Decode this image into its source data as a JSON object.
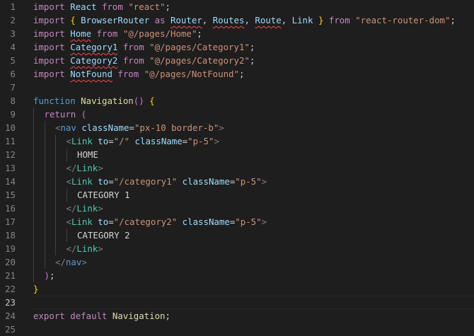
{
  "editor": {
    "lines": [
      {
        "n": "1",
        "indent": 0,
        "tokens": [
          [
            "import",
            "ctl"
          ],
          [
            " ",
            "txt"
          ],
          [
            "React",
            "var"
          ],
          [
            " ",
            "txt"
          ],
          [
            "from",
            "ctl"
          ],
          [
            " ",
            "txt"
          ],
          [
            "\"react\"",
            "str"
          ],
          [
            ";",
            "txt"
          ]
        ]
      },
      {
        "n": "2",
        "indent": 0,
        "tokens": [
          [
            "import",
            "ctl"
          ],
          [
            " ",
            "txt"
          ],
          [
            "{",
            "br1"
          ],
          [
            " ",
            "txt"
          ],
          [
            "BrowserRouter",
            "var"
          ],
          [
            " ",
            "txt"
          ],
          [
            "as",
            "ctl"
          ],
          [
            " ",
            "txt"
          ],
          [
            "Router",
            "var",
            "sq"
          ],
          [
            ", ",
            "txt"
          ],
          [
            "Routes",
            "var",
            "sq"
          ],
          [
            ", ",
            "txt"
          ],
          [
            "Route",
            "var",
            "sq"
          ],
          [
            ", ",
            "txt"
          ],
          [
            "Link",
            "var"
          ],
          [
            " ",
            "txt"
          ],
          [
            "}",
            "br1"
          ],
          [
            " ",
            "txt"
          ],
          [
            "from",
            "ctl"
          ],
          [
            " ",
            "txt"
          ],
          [
            "\"react-router-dom\"",
            "str"
          ],
          [
            ";",
            "txt"
          ]
        ]
      },
      {
        "n": "3",
        "indent": 0,
        "tokens": [
          [
            "import",
            "ctl"
          ],
          [
            " ",
            "txt"
          ],
          [
            "Home",
            "var",
            "sq"
          ],
          [
            " ",
            "txt"
          ],
          [
            "from",
            "ctl"
          ],
          [
            " ",
            "txt"
          ],
          [
            "\"@/pages/Home\"",
            "str"
          ],
          [
            ";",
            "txt"
          ]
        ]
      },
      {
        "n": "4",
        "indent": 0,
        "tokens": [
          [
            "import",
            "ctl"
          ],
          [
            " ",
            "txt"
          ],
          [
            "Category1",
            "var",
            "sq"
          ],
          [
            " ",
            "txt"
          ],
          [
            "from",
            "ctl"
          ],
          [
            " ",
            "txt"
          ],
          [
            "\"@/pages/Category1\"",
            "str"
          ],
          [
            ";",
            "txt"
          ]
        ]
      },
      {
        "n": "5",
        "indent": 0,
        "tokens": [
          [
            "import",
            "ctl"
          ],
          [
            " ",
            "txt"
          ],
          [
            "Category2",
            "var",
            "sq"
          ],
          [
            " ",
            "txt"
          ],
          [
            "from",
            "ctl"
          ],
          [
            " ",
            "txt"
          ],
          [
            "\"@/pages/Category2\"",
            "str"
          ],
          [
            ";",
            "txt"
          ]
        ]
      },
      {
        "n": "6",
        "indent": 0,
        "tokens": [
          [
            "import",
            "ctl"
          ],
          [
            " ",
            "txt"
          ],
          [
            "NotFound",
            "var",
            "sq"
          ],
          [
            " ",
            "txt"
          ],
          [
            "from",
            "ctl"
          ],
          [
            " ",
            "txt"
          ],
          [
            "\"@/pages/NotFound\"",
            "str"
          ],
          [
            ";",
            "txt"
          ]
        ]
      },
      {
        "n": "7",
        "indent": 0,
        "tokens": []
      },
      {
        "n": "8",
        "indent": 0,
        "tokens": [
          [
            "function",
            "lnkw"
          ],
          [
            " ",
            "txt"
          ],
          [
            "Navigation",
            "fn"
          ],
          [
            "()",
            "br2"
          ],
          [
            " ",
            "txt"
          ],
          [
            "{",
            "br1"
          ]
        ]
      },
      {
        "n": "9",
        "indent": 1,
        "tokens": [
          [
            "return",
            "ctl"
          ],
          [
            " ",
            "txt"
          ],
          [
            "(",
            "br2"
          ]
        ]
      },
      {
        "n": "10",
        "indent": 2,
        "tokens": [
          [
            "<",
            "punc"
          ],
          [
            "nav",
            "tag"
          ],
          [
            " ",
            "txt"
          ],
          [
            "className",
            "var"
          ],
          [
            "=",
            "txt"
          ],
          [
            "\"px-10 border-b\"",
            "str"
          ],
          [
            ">",
            "punc"
          ]
        ]
      },
      {
        "n": "11",
        "indent": 3,
        "tokens": [
          [
            "<",
            "punc"
          ],
          [
            "Link",
            "cmp"
          ],
          [
            " ",
            "txt"
          ],
          [
            "to",
            "var"
          ],
          [
            "=",
            "txt"
          ],
          [
            "\"/\"",
            "str"
          ],
          [
            " ",
            "txt"
          ],
          [
            "className",
            "var"
          ],
          [
            "=",
            "txt"
          ],
          [
            "\"p-5\"",
            "str"
          ],
          [
            ">",
            "punc"
          ]
        ]
      },
      {
        "n": "12",
        "indent": 4,
        "tokens": [
          [
            "HOME",
            "txt"
          ]
        ]
      },
      {
        "n": "13",
        "indent": 3,
        "tokens": [
          [
            "</",
            "punc"
          ],
          [
            "Link",
            "cmp"
          ],
          [
            ">",
            "punc"
          ]
        ]
      },
      {
        "n": "14",
        "indent": 3,
        "tokens": [
          [
            "<",
            "punc"
          ],
          [
            "Link",
            "cmp"
          ],
          [
            " ",
            "txt"
          ],
          [
            "to",
            "var"
          ],
          [
            "=",
            "txt"
          ],
          [
            "\"/category1\"",
            "str"
          ],
          [
            " ",
            "txt"
          ],
          [
            "className",
            "var"
          ],
          [
            "=",
            "txt"
          ],
          [
            "\"p-5\"",
            "str"
          ],
          [
            ">",
            "punc"
          ]
        ]
      },
      {
        "n": "15",
        "indent": 4,
        "tokens": [
          [
            "CATEGORY 1",
            "txt"
          ]
        ]
      },
      {
        "n": "16",
        "indent": 3,
        "tokens": [
          [
            "</",
            "punc"
          ],
          [
            "Link",
            "cmp"
          ],
          [
            ">",
            "punc"
          ]
        ]
      },
      {
        "n": "17",
        "indent": 3,
        "tokens": [
          [
            "<",
            "punc"
          ],
          [
            "Link",
            "cmp"
          ],
          [
            " ",
            "txt"
          ],
          [
            "to",
            "var"
          ],
          [
            "=",
            "txt"
          ],
          [
            "\"/category2\"",
            "str"
          ],
          [
            " ",
            "txt"
          ],
          [
            "className",
            "var"
          ],
          [
            "=",
            "txt"
          ],
          [
            "\"p-5\"",
            "str"
          ],
          [
            ">",
            "punc"
          ]
        ]
      },
      {
        "n": "18",
        "indent": 4,
        "tokens": [
          [
            "CATEGORY 2",
            "txt"
          ]
        ]
      },
      {
        "n": "19",
        "indent": 3,
        "tokens": [
          [
            "</",
            "punc"
          ],
          [
            "Link",
            "cmp"
          ],
          [
            ">",
            "punc"
          ]
        ]
      },
      {
        "n": "20",
        "indent": 2,
        "tokens": [
          [
            "</",
            "punc"
          ],
          [
            "nav",
            "tag"
          ],
          [
            ">",
            "punc"
          ]
        ]
      },
      {
        "n": "21",
        "indent": 1,
        "tokens": [
          [
            ")",
            "br2"
          ],
          [
            ";",
            "txt"
          ]
        ]
      },
      {
        "n": "22",
        "indent": 0,
        "tokens": [
          [
            "}",
            "br1"
          ]
        ]
      },
      {
        "n": "23",
        "indent": 0,
        "tokens": [],
        "active": true
      },
      {
        "n": "24",
        "indent": 0,
        "tokens": [
          [
            "export",
            "ctl"
          ],
          [
            " ",
            "txt"
          ],
          [
            "default",
            "ctl"
          ],
          [
            " ",
            "txt"
          ],
          [
            "Navigation",
            "fn"
          ],
          [
            ";",
            "txt"
          ]
        ]
      },
      {
        "n": "25",
        "indent": 0,
        "tokens": []
      }
    ]
  }
}
